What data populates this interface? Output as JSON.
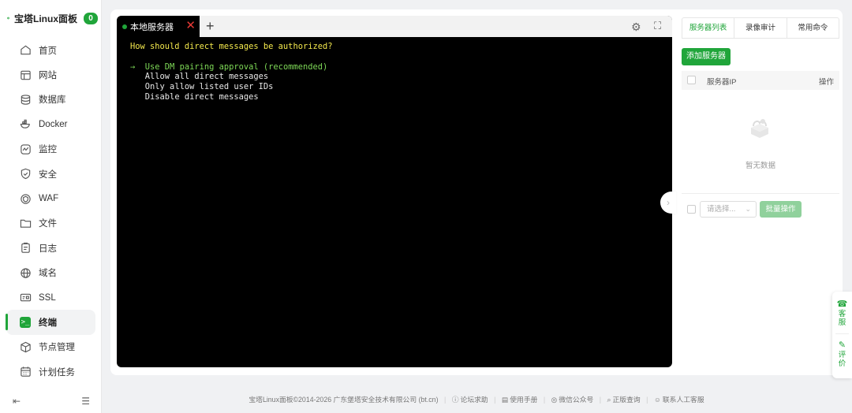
{
  "brand": {
    "title": "宝塔Linux面板",
    "badge": "0"
  },
  "sidebar": {
    "items": [
      {
        "label": "首页",
        "icon": "home-icon"
      },
      {
        "label": "网站",
        "icon": "website-icon"
      },
      {
        "label": "数据库",
        "icon": "database-icon"
      },
      {
        "label": "Docker",
        "icon": "docker-icon"
      },
      {
        "label": "监控",
        "icon": "monitor-icon"
      },
      {
        "label": "安全",
        "icon": "shield-icon"
      },
      {
        "label": "WAF",
        "icon": "waf-icon"
      },
      {
        "label": "文件",
        "icon": "folder-icon"
      },
      {
        "label": "日志",
        "icon": "log-icon"
      },
      {
        "label": "域名",
        "icon": "globe-icon"
      },
      {
        "label": "SSL",
        "icon": "ssl-icon"
      },
      {
        "label": "终端",
        "icon": "terminal-icon",
        "active": true
      },
      {
        "label": "节点管理",
        "icon": "node-icon"
      },
      {
        "label": "计划任务",
        "icon": "calendar-icon"
      }
    ]
  },
  "terminal": {
    "tab_label": "本地服务器",
    "close_glyph": "✕",
    "add_glyph": "+",
    "question": "How should direct messages be authorized?",
    "selected_marker": "→",
    "options": [
      "Use DM pairing approval (recommended)",
      "Allow all direct messages",
      "Only allow listed user IDs",
      "Disable direct messages"
    ]
  },
  "right_panel": {
    "tabs": [
      "服务器列表",
      "录像审计",
      "常用命令"
    ],
    "add_button": "添加服务器",
    "col_ip": "服务器IP",
    "col_op": "操作",
    "empty_text": "暂无数据",
    "select_placeholder": "请选择...",
    "batch_button": "批量操作"
  },
  "float_bar": {
    "service": "客服",
    "feedback": "评价"
  },
  "footer": {
    "copyright": "宝塔Linux面板©2014-2026 广东堡塔安全技术有限公司 (bt.cn)",
    "links": [
      "论坛求助",
      "使用手册",
      "微信公众号",
      "正版查询",
      "联系人工客服"
    ]
  },
  "colors": {
    "accent": "#20a53a",
    "terminal_bg": "#000000",
    "question": "#f4e94d",
    "selected": "#7ed957"
  }
}
